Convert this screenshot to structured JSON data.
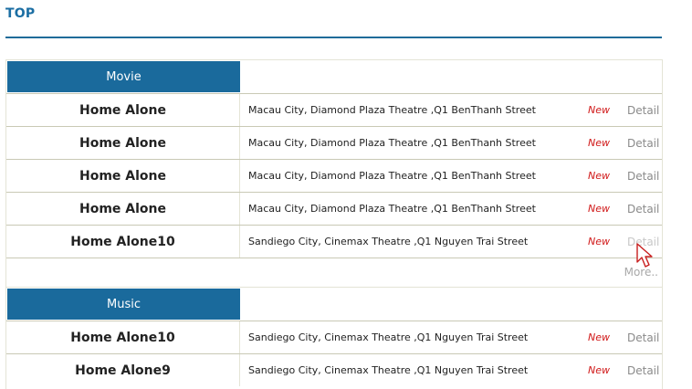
{
  "page": {
    "title": "TOP"
  },
  "sections": [
    {
      "tab_label": "Movie",
      "rows": [
        {
          "title": "Home Alone",
          "address": "Macau City, Diamond Plaza Theatre ,Q1 BenThanh Street",
          "new_label": "New",
          "detail_label": "Detail"
        },
        {
          "title": "Home Alone",
          "address": "Macau City, Diamond Plaza Theatre ,Q1 BenThanh Street",
          "new_label": "New",
          "detail_label": "Detail"
        },
        {
          "title": "Home Alone",
          "address": "Macau City, Diamond Plaza Theatre ,Q1 BenThanh Street",
          "new_label": "New",
          "detail_label": "Detail"
        },
        {
          "title": "Home Alone",
          "address": "Macau City, Diamond Plaza Theatre ,Q1 BenThanh Street",
          "new_label": "New",
          "detail_label": "Detail"
        },
        {
          "title": "Home Alone10",
          "address": "Sandiego City, Cinemax Theatre ,Q1 Nguyen Trai Street",
          "new_label": "New",
          "detail_label": "Detail"
        }
      ],
      "more_label": "More.."
    },
    {
      "tab_label": "Music",
      "rows": [
        {
          "title": "Home Alone10",
          "address": "Sandiego City, Cinemax Theatre ,Q1 Nguyen Trai Street",
          "new_label": "New",
          "detail_label": "Detail"
        },
        {
          "title": "Home Alone9",
          "address": "Sandiego City, Cinemax Theatre ,Q1 Nguyen Trai Street",
          "new_label": "New",
          "detail_label": "Detail"
        }
      ]
    }
  ],
  "colors": {
    "accent": "#1a6a9c",
    "new_badge": "#d01818",
    "detail_link": "#8a8a8a"
  },
  "icons": {
    "cursor": "mouse-pointer-icon"
  }
}
